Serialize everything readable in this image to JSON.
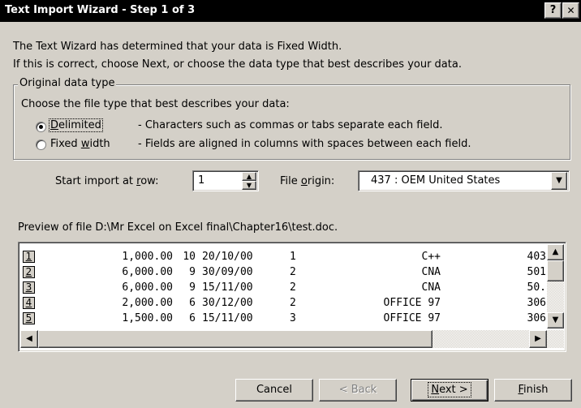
{
  "window": {
    "title": "Text Import Wizard - Step 1 of 3",
    "help_button": "?",
    "close_button": "✕"
  },
  "intro": {
    "line1": "The Text Wizard has determined that your data is Fixed Width.",
    "line2": "If this is correct, choose Next, or choose the data type that best describes your data."
  },
  "original_data_type": {
    "group_label": "Original data type",
    "prompt": "Choose the file type that best describes your data:",
    "options": [
      {
        "label": "Delimited",
        "mnemonic": "D",
        "rest": "elimited",
        "description": "- Characters such as commas or tabs separate each field.",
        "selected": true
      },
      {
        "label_pre": "Fixed ",
        "mnemonic": "w",
        "rest": "idth",
        "description": "- Fields are aligned in columns with spaces between each field.",
        "selected": false
      }
    ]
  },
  "start_import": {
    "label_pre": "Start import at ",
    "mnemonic": "r",
    "label_post": "ow:",
    "value": "1"
  },
  "file_origin": {
    "label_pre": "File ",
    "mnemonic": "o",
    "label_post": "rigin:",
    "value": "437 : OEM United States"
  },
  "preview": {
    "label": "Preview of file D:\\Mr Excel on Excel final\\Chapter16\\test.doc.",
    "rows": [
      {
        "num": "1",
        "amount": "1,000.00",
        "qty": "10",
        "date": "20/10/00",
        "code": "1",
        "product": "C++",
        "last": "403"
      },
      {
        "num": "2",
        "amount": "6,000.00",
        "qty": "9",
        "date": "30/09/00",
        "code": "2",
        "product": "CNA",
        "last": "501"
      },
      {
        "num": "3",
        "amount": "6,000.00",
        "qty": "9",
        "date": "15/11/00",
        "code": "2",
        "product": "CNA",
        "last": "50."
      },
      {
        "num": "4",
        "amount": "2,000.00",
        "qty": "6",
        "date": "30/12/00",
        "code": "2",
        "product": "OFFICE 97",
        "last": "306"
      },
      {
        "num": "5",
        "amount": "1,500.00",
        "qty": "6",
        "date": "15/11/00",
        "code": "3",
        "product": "OFFICE 97",
        "last": "306"
      }
    ]
  },
  "buttons": {
    "cancel": "Cancel",
    "back": "< Back",
    "back_mnemonic": "B",
    "next_mnemonic": "N",
    "next_rest": "ext >",
    "finish_mnemonic": "F",
    "finish_rest": "inish"
  },
  "icons": {
    "spin_up": "▲",
    "spin_down": "▼",
    "dropdown": "▼",
    "scroll_up": "▲",
    "scroll_down": "▼",
    "scroll_left": "◀",
    "scroll_right": "▶"
  }
}
